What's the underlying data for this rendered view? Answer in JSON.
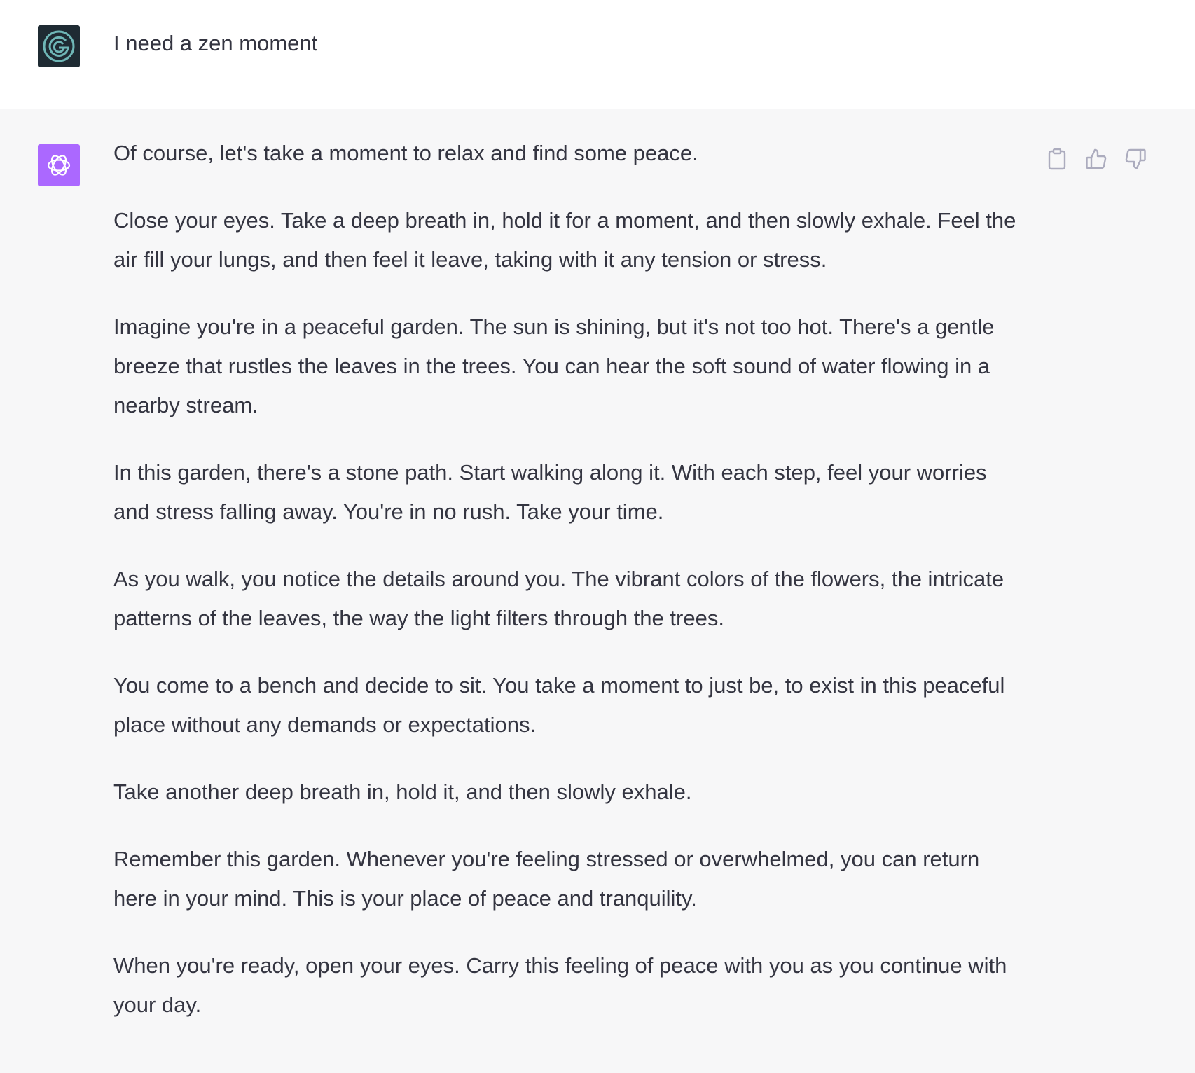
{
  "conversation": {
    "user_message": {
      "text": "I need a zen moment",
      "avatar_icon": "user-avatar-icon"
    },
    "assistant_message": {
      "avatar_icon": "openai-logo-icon",
      "avatar_color": "#ab68ff",
      "paragraphs": [
        "Of course, let's take a moment to relax and find some peace.",
        "Close your eyes. Take a deep breath in, hold it for a moment, and then slowly exhale. Feel the air fill your lungs, and then feel it leave, taking with it any tension or stress.",
        "Imagine you're in a peaceful garden. The sun is shining, but it's not too hot. There's a gentle breeze that rustles the leaves in the trees. You can hear the soft sound of water flowing in a nearby stream.",
        "In this garden, there's a stone path. Start walking along it. With each step, feel your worries and stress falling away. You're in no rush. Take your time.",
        "As you walk, you notice the details around you. The vibrant colors of the flowers, the intricate patterns of the leaves, the way the light filters through the trees.",
        "You come to a bench and decide to sit. You take a moment to just be, to exist in this peaceful place without any demands or expectations.",
        "Take another deep breath in, hold it, and then slowly exhale.",
        "Remember this garden. Whenever you're feeling stressed or overwhelmed, you can return here in your mind. This is your place of peace and tranquility.",
        "When you're ready, open your eyes. Carry this feeling of peace with you as you continue with your day."
      ],
      "actions": [
        "copy-icon",
        "thumbs-up-icon",
        "thumbs-down-icon"
      ]
    }
  }
}
